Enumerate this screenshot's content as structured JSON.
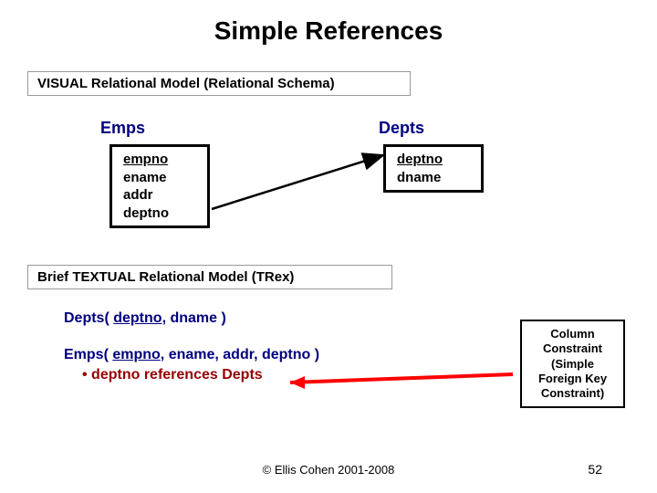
{
  "title": "Simple References",
  "section1_label": "VISUAL Relational Model (Relational Schema)",
  "section2_label": "Brief TEXTUAL Relational Model (TRex)",
  "visual": {
    "emps_name": "Emps",
    "depts_name": "Depts",
    "emps_cols": {
      "c1": "empno",
      "c2": "ename",
      "c3": "addr",
      "c4": "deptno"
    },
    "depts_cols": {
      "c1": "deptno",
      "c2": "dname"
    }
  },
  "trex": {
    "line1_pre": "Depts( ",
    "line1_key": "deptno",
    "line1_post": ", dname )",
    "line2_pre": "Emps( ",
    "line2_key": "empno",
    "line2_post": ", ename, addr, deptno )",
    "line3_bullet": "•",
    "line3_text": " deptno references Depts"
  },
  "callout": {
    "l1": "Column",
    "l2": "Constraint",
    "l3": "(Simple",
    "l4": "Foreign Key",
    "l5": "Constraint)"
  },
  "footer": {
    "copyright": "© Ellis Cohen 2001-2008",
    "page": "52"
  }
}
